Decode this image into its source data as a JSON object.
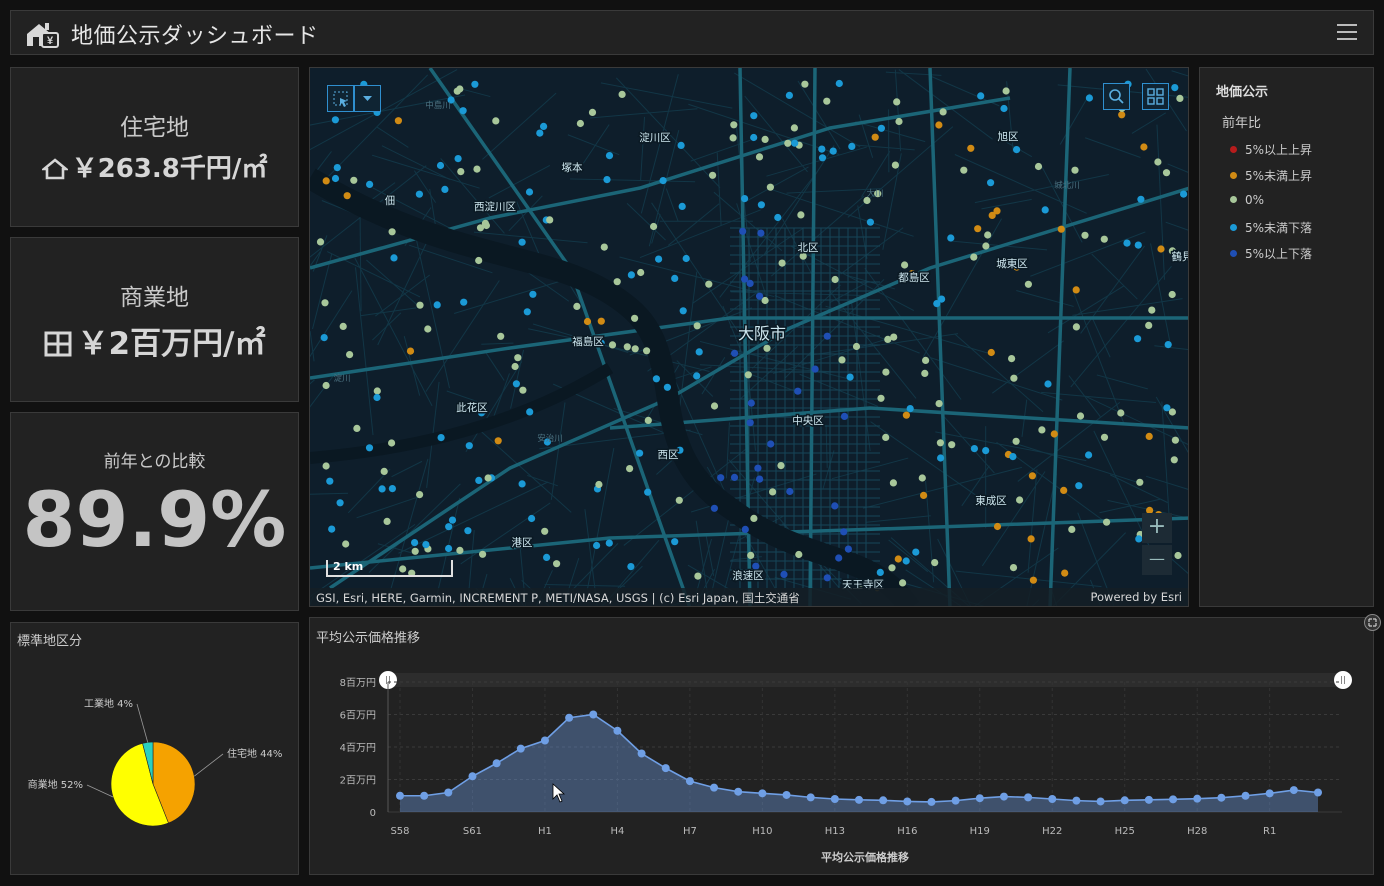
{
  "header": {
    "title": "地価公示ダッシュボード"
  },
  "indicators": [
    {
      "title": "住宅地",
      "value": "￥263.8千円/㎡",
      "icon": "house-icon"
    },
    {
      "title": "商業地",
      "value": "￥2百万円/㎡",
      "icon": "building-icon"
    },
    {
      "title": "前年との比較",
      "value": "89.9%"
    }
  ],
  "map": {
    "city_label": "大阪市",
    "districts": [
      "淀川区",
      "旭区",
      "西淀川区",
      "北区",
      "都島区",
      "城東区",
      "福島区",
      "此花区",
      "中央区",
      "西区",
      "港区",
      "浪速区",
      "天王寺区",
      "東成区",
      "佃",
      "塚本",
      "鶴見"
    ],
    "rivers": [
      "中島川",
      "淀川",
      "安治川",
      "大川",
      "城北川"
    ],
    "scale": "2 km",
    "attribution": "GSI, Esri, HERE, Garmin, INCREMENT P, METI/NASA, USGS | (c) Esri Japan, 国土交通省",
    "powered_by": "Powered by Esri",
    "zoom_in": "+",
    "zoom_out": "—"
  },
  "legend": {
    "title": "地価公示",
    "subtitle": "前年比",
    "items": [
      {
        "label": "5%以上上昇",
        "color": "#b71c1c"
      },
      {
        "label": "5%未満上昇",
        "color": "#d18b14"
      },
      {
        "label": "0%",
        "color": "#a8c79a"
      },
      {
        "label": "5%未満下落",
        "color": "#1b9ad6"
      },
      {
        "label": "5%以上下落",
        "color": "#1f4fb5"
      }
    ]
  },
  "pie": {
    "title": "標準地区分"
  },
  "line": {
    "title": "平均公示価格推移",
    "expand_icon": "expand-icon"
  },
  "chart_data": [
    {
      "type": "pie",
      "title": "標準地区分",
      "slices": [
        {
          "label": "住宅地 44%",
          "value": 44,
          "color": "#f5a200"
        },
        {
          "label": "商業地 52%",
          "value": 52,
          "color": "#ffff00"
        },
        {
          "label": "工業地 4%",
          "value": 4,
          "color": "#2ad0c0"
        }
      ]
    },
    {
      "type": "area",
      "title": "平均公示価格推移",
      "xlabel": "平均公示価格推移",
      "ylabel": "",
      "ylim": [
        0,
        8
      ],
      "y_ticks": [
        {
          "value": 0,
          "label": "0"
        },
        {
          "value": 2,
          "label": "2百万円"
        },
        {
          "value": 4,
          "label": "4百万円"
        },
        {
          "value": 6,
          "label": "6百万円"
        },
        {
          "value": 8,
          "label": "8百万円"
        }
      ],
      "x_tick_labels": [
        "S58",
        "S61",
        "H1",
        "H4",
        "H7",
        "H10",
        "H13",
        "H16",
        "H19",
        "H22",
        "H25",
        "H28",
        "R1"
      ],
      "x_tick_index": [
        0,
        3,
        6,
        9,
        12,
        15,
        18,
        21,
        24,
        27,
        30,
        33,
        36
      ],
      "values": [
        1.0,
        1.0,
        1.2,
        2.2,
        3.0,
        3.9,
        4.4,
        5.8,
        6.0,
        5.0,
        3.6,
        2.7,
        1.9,
        1.5,
        1.25,
        1.15,
        1.05,
        0.9,
        0.8,
        0.75,
        0.72,
        0.65,
        0.62,
        0.7,
        0.85,
        0.95,
        0.9,
        0.8,
        0.7,
        0.65,
        0.72,
        0.75,
        0.78,
        0.82,
        0.88,
        1.0,
        1.15,
        1.35,
        1.2
      ],
      "grid": true,
      "color": "#6f9fe5"
    }
  ]
}
